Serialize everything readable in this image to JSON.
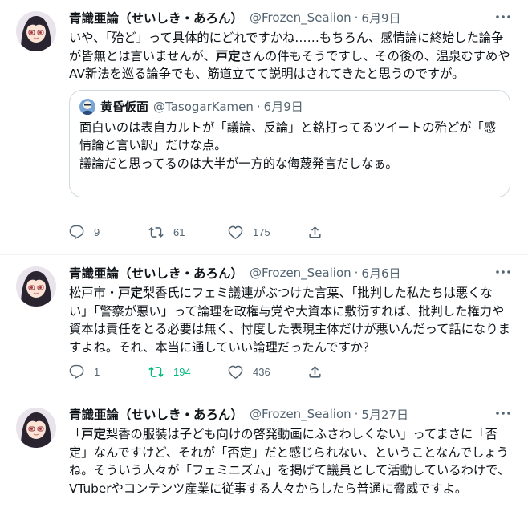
{
  "tweets": [
    {
      "name": "青識亜論（せいしき・あろん）",
      "handle": "@Frozen_Sealion",
      "separator": "·",
      "date": "6月9日",
      "text_parts": [
        "いや、「殆ど」って具体的にどれですかね……もちろん、感情論に終始した論争が皆無とは言いませんが、",
        "戸定",
        "さんの件もそうですし、その後の、温泉むすめやAV新法を巡る論争でも、筋道立てて説明はされてきたと思うのですが。"
      ],
      "quote": {
        "name": "黄昏仮面",
        "handle": "@TasogarKamen",
        "separator": "·",
        "date": "6月9日",
        "text": "面白いのは表自カルトが「議論、反論」と銘打ってるツイートの殆どが「感情論と言い訳」だけな点。\n議論だと思ってるのは大半が一方的な侮蔑発言だしなぁ。"
      },
      "replies": "9",
      "retweets": "61",
      "likes": "175"
    },
    {
      "name": "青識亜論（せいしき・あろん）",
      "handle": "@Frozen_Sealion",
      "separator": "·",
      "date": "6月6日",
      "text_parts": [
        "松戸市・",
        "戸定",
        "梨香氏にフェミ議連がぶつけた言葉、「批判した私たちは悪くない」「警察が悪い」って論理を政権与党や大資本に敷衍すれば、批判した権力や資本は責任をとる必要は無く、忖度した表現主体だけが悪いんだって話になりますよね。それ、本当に通していい論理だったんですか？"
      ],
      "replies": "1",
      "retweets": "194",
      "likes": "436"
    },
    {
      "name": "青識亜論（せいしき・あろん）",
      "handle": "@Frozen_Sealion",
      "separator": "·",
      "date": "5月27日",
      "text_parts": [
        "「",
        "戸定",
        "梨香の服装は子ども向けの啓発動画にふさわしくない」ってまさに「否定」なんですけど、それが「否定」だと感じられない、ということなんでしょうね。そういう人々が「フェミニズム」を掲げて議員として活動しているわけで、VTuberやコンテンツ産業に従事する人々からしたら普通に脅威ですよ。"
      ]
    }
  ],
  "colors": {
    "text": "#0f1419",
    "secondary": "#536471",
    "retweet_active": "#00ba7c",
    "border": "#cfd9de"
  },
  "icons": [
    "more-icon",
    "reply-icon",
    "retweet-icon",
    "like-icon",
    "share-icon"
  ]
}
